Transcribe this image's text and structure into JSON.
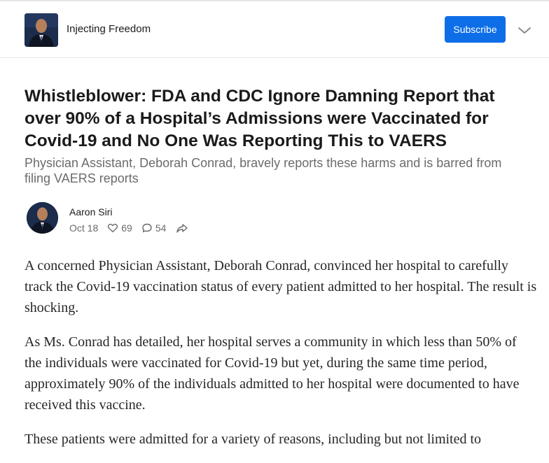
{
  "header": {
    "publication_name": "Injecting Freedom",
    "subscribe_label": "Subscribe",
    "accent_color": "#0d6ee8"
  },
  "article": {
    "title": "Whistleblower: FDA and CDC Ignore Damning Report that over 90% of a Hospital’s Admissions were Vaccinated for Covid-19 and No One Was Reporting This to VAERS",
    "subtitle": "Physician Assistant, Deborah Conrad, bravely reports these harms and is barred from filing VAERS reports",
    "author": "Aaron Siri",
    "date": "Oct 18",
    "likes": "69",
    "comments": "54",
    "icons": [
      "heart-icon",
      "comment-icon",
      "share-icon",
      "chevron-down-icon"
    ],
    "paragraphs": [
      "A concerned Physician Assistant, Deborah Conrad, convinced her hospital to carefully track the Covid-19 vaccination status of every patient admitted to her hospital.  The result is shocking.",
      "As Ms. Conrad has detailed, her hospital serves a community in which less than 50% of the individuals were vaccinated for Covid-19 but yet, during the same time period, approximately 90% of the individuals admitted to her hospital were documented to have received this vaccine.",
      "These patients were admitted for a variety of reasons, including but not limited to"
    ]
  }
}
